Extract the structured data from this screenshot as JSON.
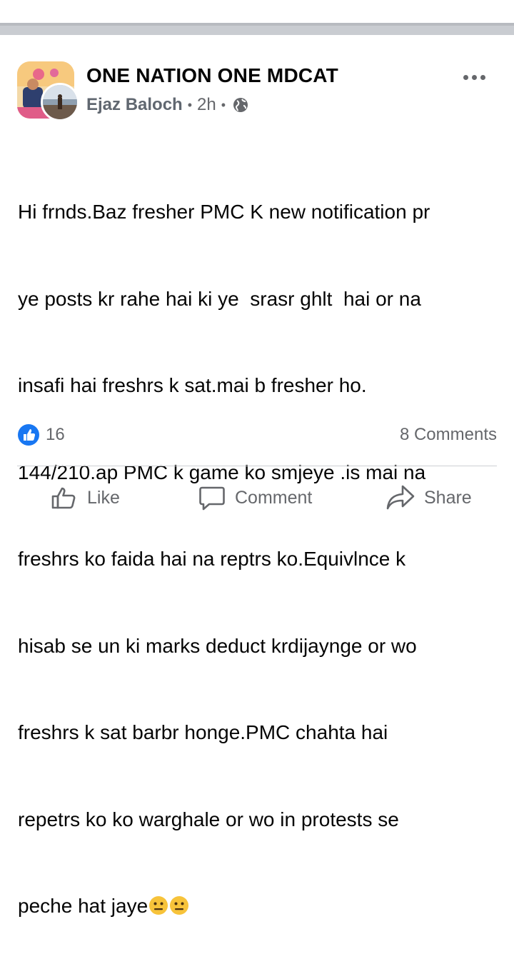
{
  "post": {
    "group_name": "ONE NATION ONE MDCAT",
    "author": "Ejaz Baloch",
    "separator": "•",
    "time": "2h",
    "lines": [
      "Hi frnds.Baz fresher PMC K new notification pr",
      "ye posts kr rahe hai ki ye  srasr ghlt  hai or na",
      "insafi hai freshrs k sat.mai b fresher ho.",
      "144/210.ap PMC k game ko smjeye .is mai na",
      "freshrs ko faida hai na reptrs ko.Equivlnce k",
      "hisab se un ki marks deduct krdijaynge or wo",
      "freshrs k sat barbr honge.PMC chahta hai",
      "repetrs ko ko warghale or wo in protests se",
      "peche hat jaye"
    ],
    "trailing_emojis": [
      "neutral-face-icon",
      "neutral-face-icon"
    ],
    "like_count": "16",
    "comments_count": "8 Comments"
  },
  "actions": {
    "like": "Like",
    "comment": "Comment",
    "share": "Share"
  },
  "colors": {
    "like_blue": "#1877f2",
    "secondary_text": "#65676b",
    "divider": "#c9ccd1"
  }
}
